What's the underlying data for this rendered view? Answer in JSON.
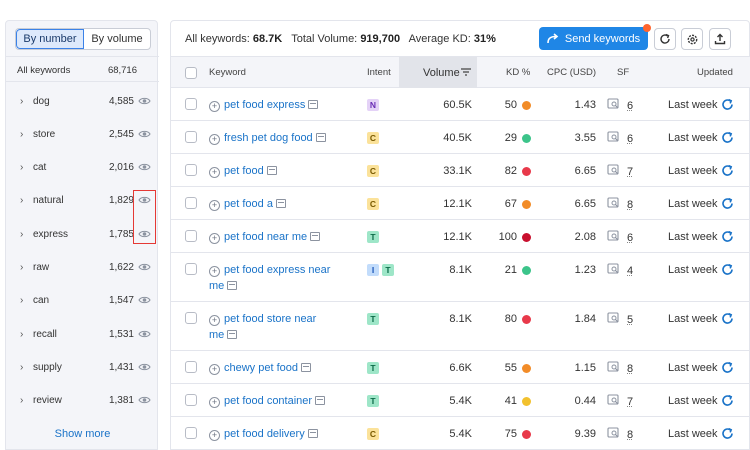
{
  "left_panel": {
    "toggle": {
      "by_number": "By number",
      "by_volume": "By volume"
    },
    "header": {
      "label": "All keywords",
      "count": "68,716"
    },
    "groups": [
      {
        "label": "dog",
        "count": "4,585"
      },
      {
        "label": "store",
        "count": "2,545"
      },
      {
        "label": "cat",
        "count": "2,016"
      },
      {
        "label": "natural",
        "count": "1,829"
      },
      {
        "label": "express",
        "count": "1,785"
      },
      {
        "label": "raw",
        "count": "1,622"
      },
      {
        "label": "can",
        "count": "1,547"
      },
      {
        "label": "recall",
        "count": "1,531"
      },
      {
        "label": "supply",
        "count": "1,431"
      },
      {
        "label": "review",
        "count": "1,381"
      }
    ],
    "show_more": "Show more",
    "highlight_color": "#e53935"
  },
  "topbar": {
    "all_keywords_label": "All keywords:",
    "all_keywords_value": "68.7K",
    "total_volume_label": "Total Volume:",
    "total_volume_value": "919,700",
    "avg_kd_label": "Average KD:",
    "avg_kd_value": "31%",
    "send_keywords": "Send keywords",
    "accent_color": "#1f86e6"
  },
  "table": {
    "columns": {
      "keyword": "Keyword",
      "intent": "Intent",
      "volume": "Volume",
      "kd": "KD %",
      "cpc": "CPC (USD)",
      "sf": "SF",
      "updated": "Updated"
    },
    "rows": [
      {
        "keyword": "pet food express",
        "intent": [
          "N"
        ],
        "volume": "60.5K",
        "kd": "50",
        "kd_color": "#f28c28",
        "cpc": "1.43",
        "sf": "6",
        "updated": "Last week"
      },
      {
        "keyword": "fresh pet dog food",
        "intent": [
          "C"
        ],
        "volume": "40.5K",
        "kd": "29",
        "kd_color": "#3cc48a",
        "cpc": "3.55",
        "sf": "6",
        "updated": "Last week"
      },
      {
        "keyword": "pet food",
        "intent": [
          "C"
        ],
        "volume": "33.1K",
        "kd": "82",
        "kd_color": "#e8394a",
        "cpc": "6.65",
        "sf": "7",
        "updated": "Last week"
      },
      {
        "keyword": "pet food a",
        "intent": [
          "C"
        ],
        "volume": "12.1K",
        "kd": "67",
        "kd_color": "#f28c28",
        "cpc": "6.65",
        "sf": "8",
        "updated": "Last week"
      },
      {
        "keyword": "pet food near me",
        "intent": [
          "T"
        ],
        "volume": "12.1K",
        "kd": "100",
        "kd_color": "#c8102e",
        "cpc": "2.08",
        "sf": "6",
        "updated": "Last week"
      },
      {
        "keyword": "pet food express near me",
        "intent": [
          "I",
          "T"
        ],
        "volume": "8.1K",
        "kd": "21",
        "kd_color": "#3cc48a",
        "cpc": "1.23",
        "sf": "4",
        "updated": "Last week"
      },
      {
        "keyword": "pet food store near me",
        "intent": [
          "T"
        ],
        "volume": "8.1K",
        "kd": "80",
        "kd_color": "#e8394a",
        "cpc": "1.84",
        "sf": "5",
        "updated": "Last week"
      },
      {
        "keyword": "chewy pet food",
        "intent": [
          "T"
        ],
        "volume": "6.6K",
        "kd": "55",
        "kd_color": "#f28c28",
        "cpc": "1.15",
        "sf": "8",
        "updated": "Last week"
      },
      {
        "keyword": "pet food container",
        "intent": [
          "T"
        ],
        "volume": "5.4K",
        "kd": "41",
        "kd_color": "#f2c12e",
        "cpc": "0.44",
        "sf": "7",
        "updated": "Last week"
      },
      {
        "keyword": "pet food delivery",
        "intent": [
          "C"
        ],
        "volume": "5.4K",
        "kd": "75",
        "kd_color": "#e8394a",
        "cpc": "9.39",
        "sf": "8",
        "updated": "Last week"
      }
    ]
  }
}
